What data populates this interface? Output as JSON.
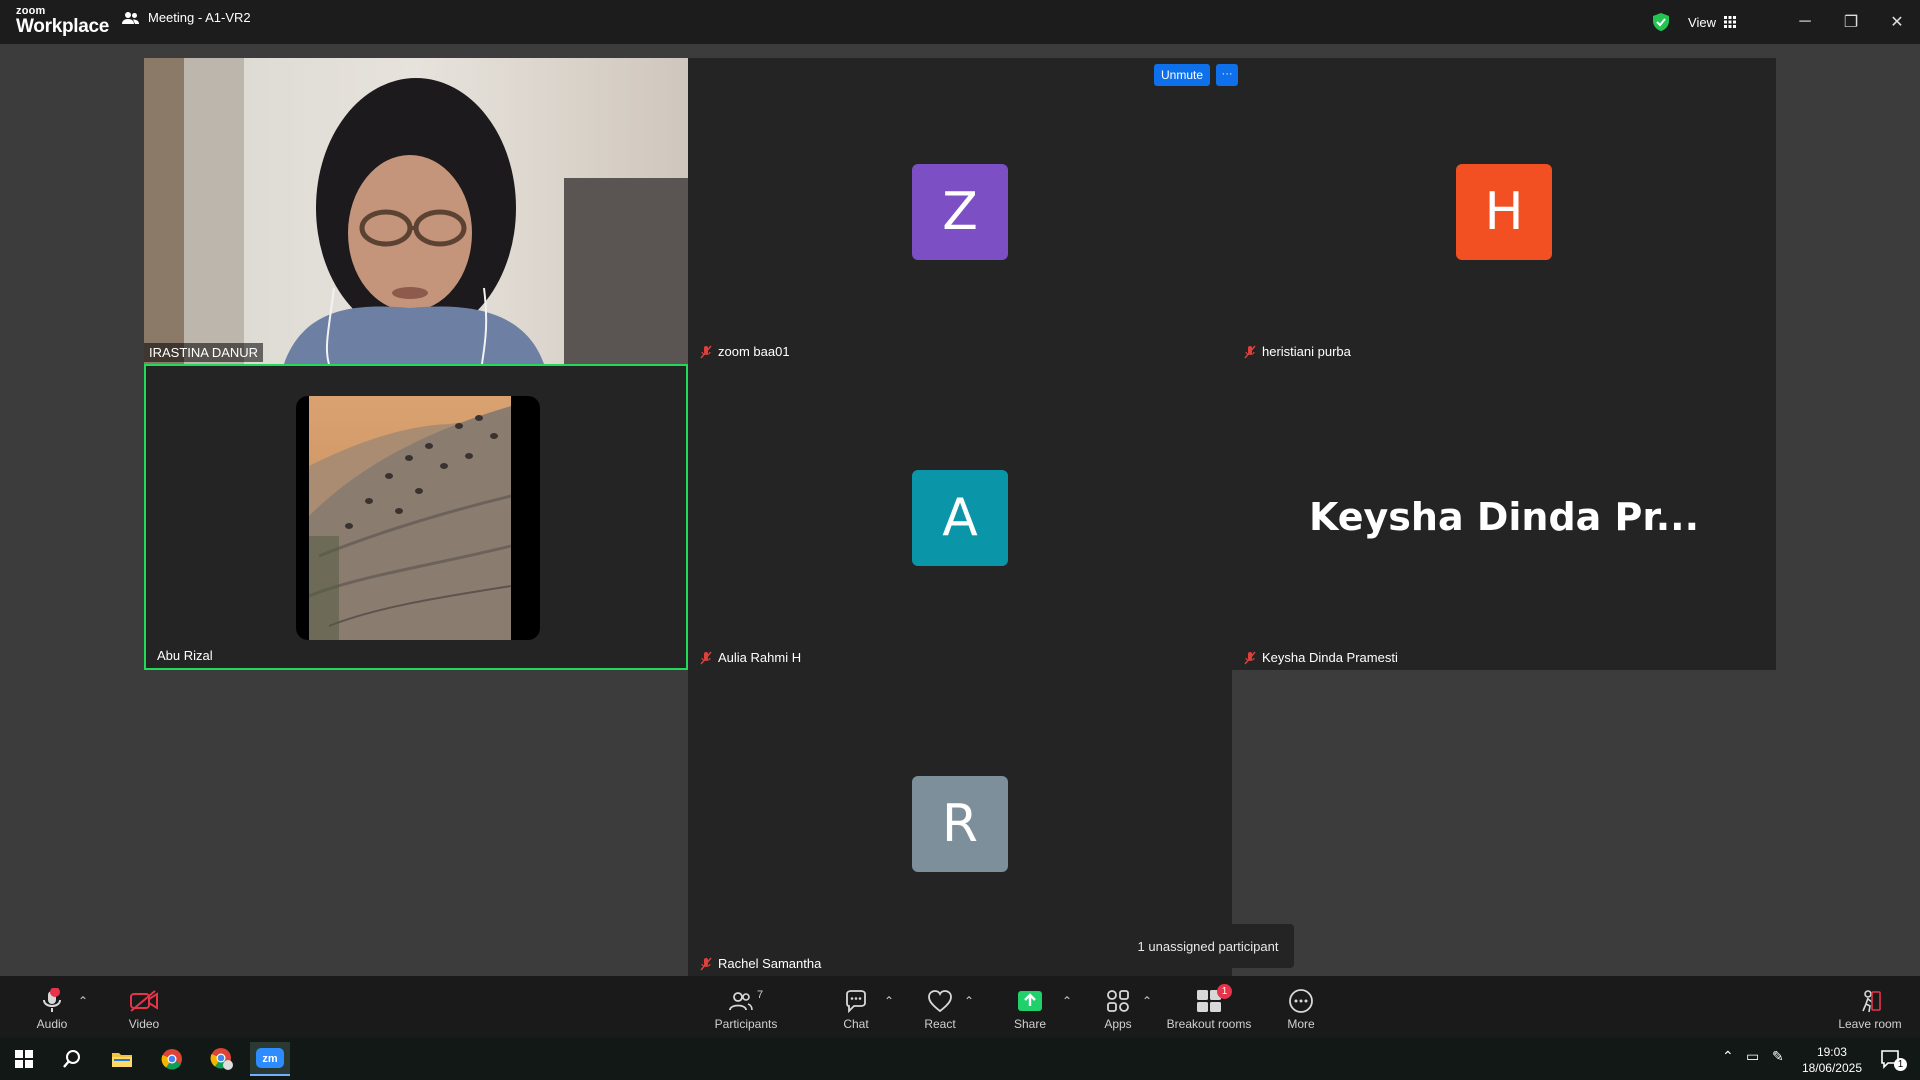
{
  "window": {
    "logo_line1": "zoom",
    "logo_line2": "Workplace",
    "meeting_title": "Meeting - A1-VR2",
    "view_label": "View"
  },
  "controls": {
    "unmute_label": "Unmute",
    "more_label": "···"
  },
  "participants": [
    {
      "name": "IRASTINA DANUR",
      "type": "video"
    },
    {
      "name": "zoom baa01",
      "type": "avatar",
      "initial": "Z",
      "color": "#7c4fc4",
      "muted": true
    },
    {
      "name": "heristiani purba",
      "type": "avatar",
      "initial": "H",
      "color": "#f25022",
      "muted": true
    },
    {
      "name": "Abu Rizal",
      "type": "image",
      "active_speaker": true
    },
    {
      "name": "Aulia Rahmi H",
      "type": "avatar",
      "initial": "A",
      "color": "#0a96a8",
      "muted": true
    },
    {
      "name": "Keysha Dinda Pramesti",
      "display": "Keysha Dinda Pr...",
      "type": "text",
      "muted": true
    },
    {
      "name": "Rachel Samantha",
      "type": "avatar",
      "initial": "R",
      "color": "#7d8f9b",
      "muted": true
    }
  ],
  "tooltip": "1 unassigned participant",
  "toolbar": {
    "audio": "Audio",
    "video": "Video",
    "participants": "Participants",
    "participants_count": "7",
    "chat": "Chat",
    "react": "React",
    "share": "Share",
    "apps": "Apps",
    "breakout": "Breakout rooms",
    "breakout_badge": "1",
    "more": "More",
    "leave": "Leave room"
  },
  "taskbar": {
    "time": "19:03",
    "date": "18/06/2025",
    "notification_count": "1"
  },
  "colors": {
    "active_border": "#23d959",
    "share_green": "#1fd06b",
    "badge_red": "#e8344a"
  }
}
